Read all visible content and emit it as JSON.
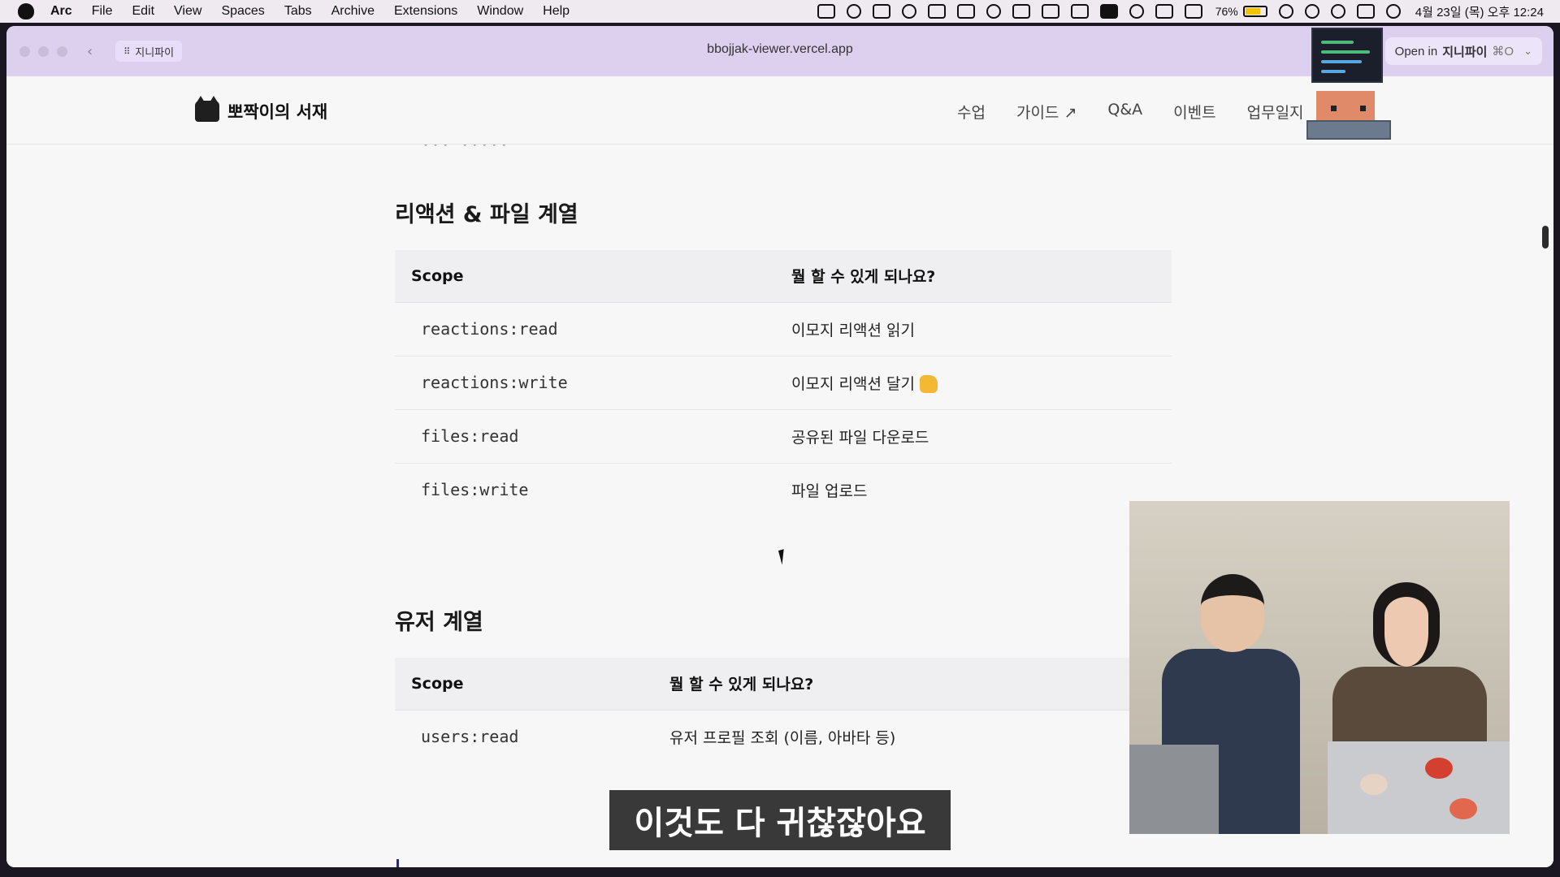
{
  "menubar": {
    "app_name": "Arc",
    "items": [
      "File",
      "Edit",
      "View",
      "Spaces",
      "Tabs",
      "Archive",
      "Extensions",
      "Window",
      "Help"
    ],
    "battery_percent": "76%",
    "battery_level": 0.76,
    "clock": "4월 23일 (목) 오후 12:24"
  },
  "browser": {
    "space_name": "지니파이",
    "url": "bbojjak-viewer.vercel.app",
    "open_in_prefix": "Open in",
    "open_in_target": "지니파이",
    "open_in_shortcut": "⌘O"
  },
  "site": {
    "name": "뽀짝이의 서재",
    "nav": [
      {
        "label": "수업"
      },
      {
        "label": "가이드 ↗"
      },
      {
        "label": "Q&A"
      },
      {
        "label": "이벤트"
      },
      {
        "label": "업무일지"
      }
    ]
  },
  "sections": [
    {
      "title": "리액션 & 파일 계열",
      "headers": [
        "Scope",
        "뭘 할 수 있게 되나요?"
      ],
      "rows": [
        {
          "scope": "reactions:read",
          "desc": "이모지 리액션 읽기"
        },
        {
          "scope": "reactions:write",
          "desc": "이모지 리액션 달기"
        },
        {
          "scope": "files:read",
          "desc": "공유된 파일 다운로드"
        },
        {
          "scope": "files:write",
          "desc": "파일 업로드"
        }
      ]
    },
    {
      "title": "유저 계열",
      "headers": [
        "Scope",
        "뭘 할 수 있게 되나요?"
      ],
      "rows": [
        {
          "scope": "users:read",
          "desc": "유저 프로필 조회 (이름, 아바타 등)"
        }
      ]
    }
  ],
  "subtitle": "이것도 다 귀찮잖아요",
  "colors": {
    "toolbar_bg": "#ddd0ee",
    "page_bg": "#f7f7f8",
    "subtitle_bg": "#282828"
  }
}
